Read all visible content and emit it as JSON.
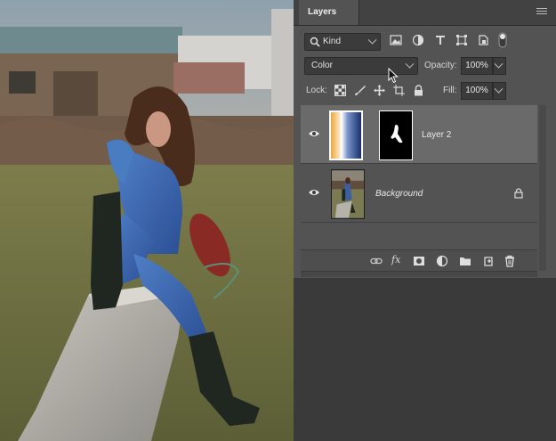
{
  "panel": {
    "tab_label": "Layers",
    "menu_icon": "panel-menu-icon"
  },
  "filter": {
    "kind_value": "Kind",
    "icons": [
      "pixel-layer-filter-icon",
      "adjustment-layer-filter-icon",
      "type-layer-filter-icon",
      "shape-layer-filter-icon",
      "smart-object-filter-icon",
      "filter-toggle-icon"
    ]
  },
  "blend": {
    "mode_value": "Color",
    "opacity_label": "Opacity:",
    "opacity_value": "100%"
  },
  "lock": {
    "label": "Lock:",
    "icons": [
      "lock-transparent-pixels-icon",
      "lock-image-pixels-icon",
      "lock-position-icon",
      "lock-artboard-icon",
      "lock-all-icon"
    ],
    "fill_label": "Fill:",
    "fill_value": "100%"
  },
  "layers": [
    {
      "name": "Layer 2",
      "visible": true,
      "selected": true,
      "has_mask": true
    },
    {
      "name": "Background",
      "visible": true,
      "selected": false,
      "locked": true,
      "italic": true
    }
  ],
  "footer": {
    "icons": [
      "link-layers-icon",
      "layer-style-fx-icon",
      "add-mask-icon",
      "new-adjustment-layer-icon",
      "new-group-icon",
      "new-layer-icon",
      "delete-layer-icon"
    ],
    "fx_label": "fx"
  },
  "colors": {
    "panel_bg": "#535353",
    "selected_row": "#6a6a6a",
    "gradient_top": "#f2a43a",
    "gradient_bottom": "#1a2f6e"
  }
}
